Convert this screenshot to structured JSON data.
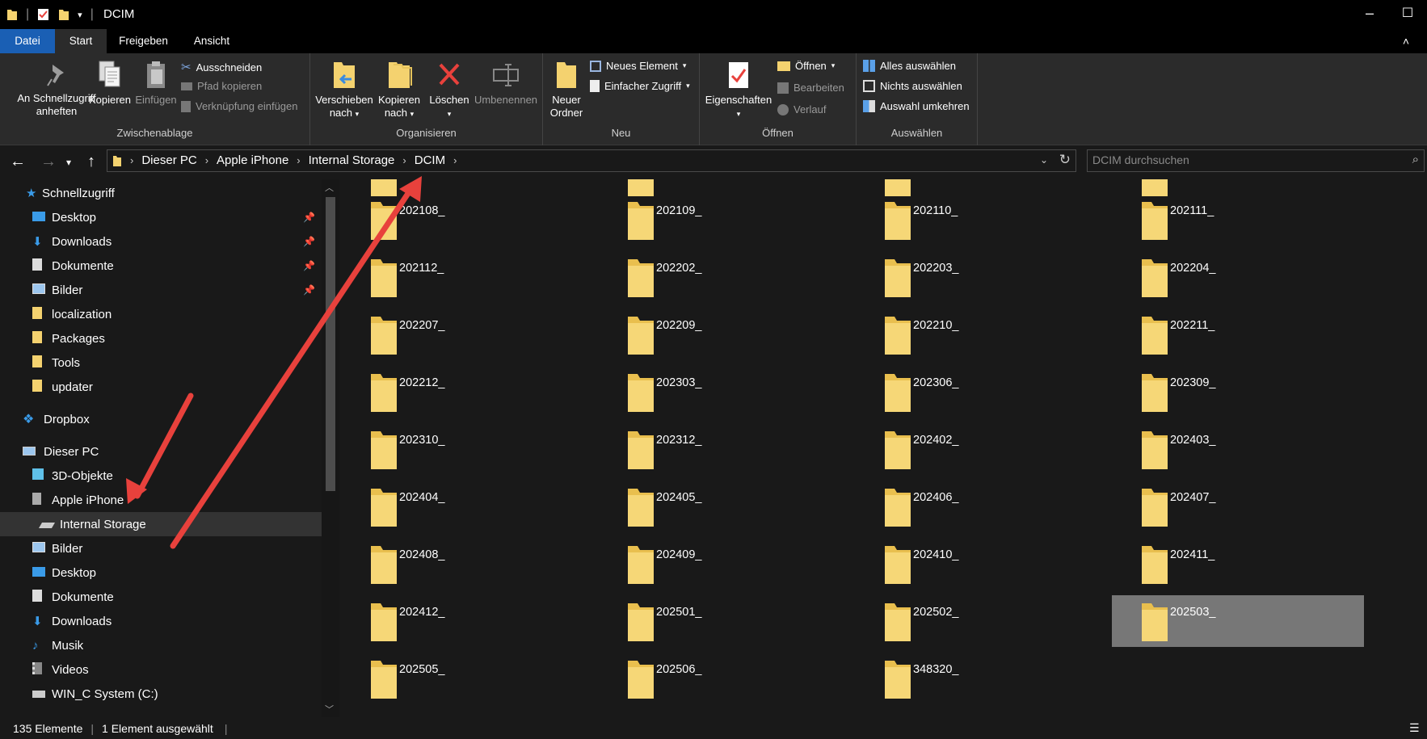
{
  "window": {
    "title": "DCIM"
  },
  "tabs": [
    "Datei",
    "Start",
    "Freigeben",
    "Ansicht"
  ],
  "ribbon": {
    "clipboard": {
      "pin_label_1": "An Schnellzugriff",
      "pin_label_2": "anheften",
      "copy": "Kopieren",
      "paste": "Einfügen",
      "cut": "Ausschneiden",
      "copy_path": "Pfad kopieren",
      "paste_shortcut": "Verknüpfung einfügen",
      "label": "Zwischenablage"
    },
    "organize": {
      "move_1": "Verschieben",
      "move_2": "nach",
      "copyto_1": "Kopieren",
      "copyto_2": "nach",
      "delete": "Löschen",
      "rename": "Umbenennen",
      "label": "Organisieren"
    },
    "new": {
      "new_folder_1": "Neuer",
      "new_folder_2": "Ordner",
      "new_item": "Neues Element",
      "easy_access": "Einfacher Zugriff",
      "label": "Neu"
    },
    "open": {
      "properties": "Eigenschaften",
      "open": "Öffnen",
      "edit": "Bearbeiten",
      "history": "Verlauf",
      "label": "Öffnen"
    },
    "select": {
      "select_all": "Alles auswählen",
      "select_none": "Nichts auswählen",
      "invert": "Auswahl umkehren",
      "label": "Auswählen"
    }
  },
  "address": {
    "crumbs": [
      "Dieser PC",
      "Apple iPhone",
      "Internal Storage",
      "DCIM"
    ],
    "search_placeholder": "DCIM durchsuchen"
  },
  "nav": {
    "quick_access": "Schnellzugriff",
    "quick_items": [
      "Desktop",
      "Downloads",
      "Dokumente",
      "Bilder",
      "localization",
      "Packages",
      "Tools",
      "updater"
    ],
    "dropbox": "Dropbox",
    "this_pc": "Dieser PC",
    "pc_items": [
      "3D-Objekte",
      "Apple iPhone",
      "Internal Storage",
      "Bilder",
      "Desktop",
      "Dokumente",
      "Downloads",
      "Musik",
      "Videos",
      "WIN_C System (C:)"
    ]
  },
  "folders": [
    "202108_",
    "202109_",
    "202110_",
    "202111_",
    "202112_",
    "202202_",
    "202203_",
    "202204_",
    "202207_",
    "202209_",
    "202210_",
    "202211_",
    "202212_",
    "202303_",
    "202306_",
    "202309_",
    "202310_",
    "202312_",
    "202402_",
    "202403_",
    "202404_",
    "202405_",
    "202406_",
    "202407_",
    "202408_",
    "202409_",
    "202410_",
    "202411_",
    "202412_",
    "202501_",
    "202502_",
    "202503_",
    "202505_",
    "202506_",
    "348320_"
  ],
  "selected_folder": "202503_",
  "status": {
    "count": "135 Elemente",
    "selection": "1 Element ausgewählt"
  },
  "colors": {
    "accent": "#1a5fb4",
    "folder": "#f4d26f",
    "arrow": "#e8413c",
    "selection": "#777777"
  }
}
